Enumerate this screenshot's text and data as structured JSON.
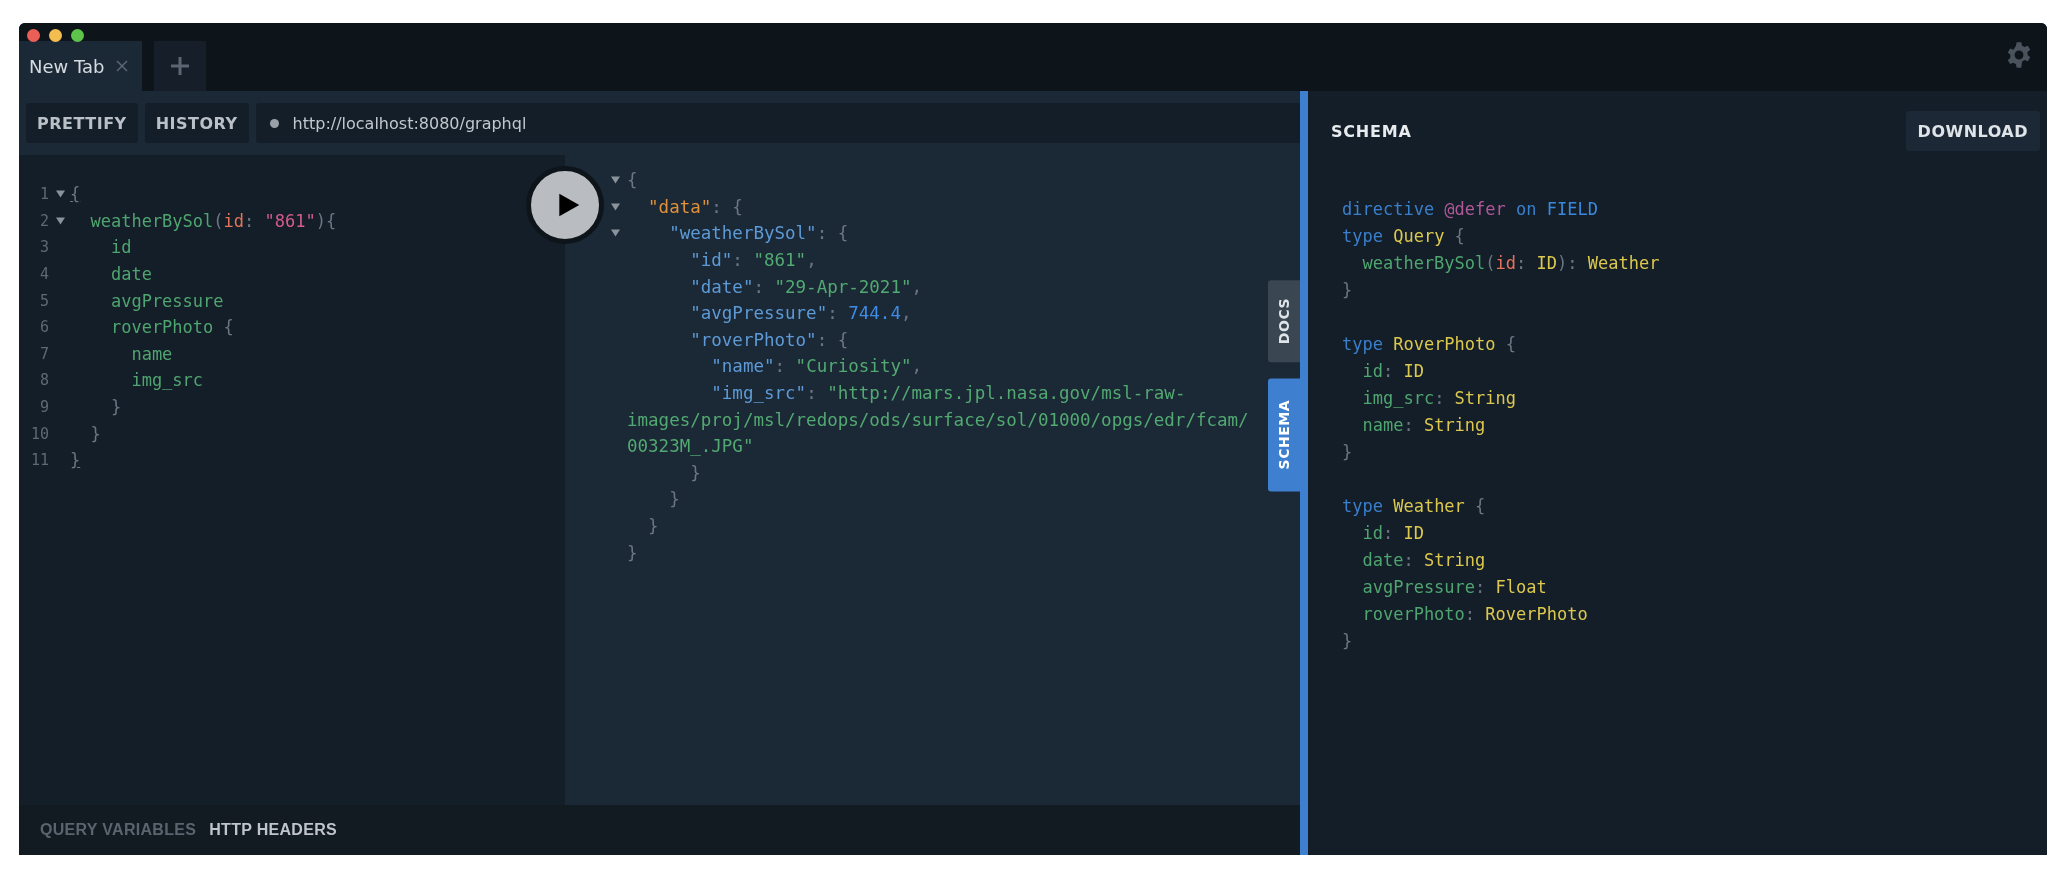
{
  "tabs": [
    {
      "label": "New Tab",
      "selected": true,
      "closable": true
    }
  ],
  "toolbar": {
    "buttons": [
      "PRETTIFY",
      "HISTORY"
    ],
    "url": "http://localhost:8080/graphql"
  },
  "query_editor": {
    "lines": [
      {
        "number": "1",
        "foldable": true,
        "tokens": [
          {
            "kind": "punct",
            "text": "{",
            "matched": true
          }
        ]
      },
      {
        "number": "2",
        "foldable": true,
        "tokens": [
          {
            "kind": "field",
            "text": "  weatherBySol"
          },
          {
            "kind": "punct",
            "text": "("
          },
          {
            "kind": "arg",
            "text": "id"
          },
          {
            "kind": "punct",
            "text": ": "
          },
          {
            "kind": "string",
            "text": "\"861\""
          },
          {
            "kind": "punct",
            "text": "){"
          }
        ]
      },
      {
        "number": "3",
        "foldable": false,
        "tokens": [
          {
            "kind": "field",
            "text": "    id"
          }
        ]
      },
      {
        "number": "4",
        "foldable": false,
        "tokens": [
          {
            "kind": "field",
            "text": "    date"
          }
        ]
      },
      {
        "number": "5",
        "foldable": false,
        "tokens": [
          {
            "kind": "field",
            "text": "    avgPressure"
          }
        ]
      },
      {
        "number": "6",
        "foldable": false,
        "tokens": [
          {
            "kind": "field",
            "text": "    roverPhoto"
          },
          {
            "kind": "punct",
            "text": " {"
          }
        ]
      },
      {
        "number": "7",
        "foldable": false,
        "tokens": [
          {
            "kind": "field",
            "text": "      name"
          }
        ]
      },
      {
        "number": "8",
        "foldable": false,
        "tokens": [
          {
            "kind": "field",
            "text": "      img_src"
          }
        ]
      },
      {
        "number": "9",
        "foldable": false,
        "tokens": [
          {
            "kind": "punct",
            "text": "    }"
          }
        ]
      },
      {
        "number": "10",
        "foldable": false,
        "tokens": [
          {
            "kind": "punct",
            "text": "  }"
          }
        ]
      },
      {
        "number": "11",
        "foldable": false,
        "tokens": [
          {
            "kind": "punct",
            "text": "}",
            "matched": true
          }
        ]
      }
    ]
  },
  "result_viewer": {
    "lines": [
      {
        "foldable": true,
        "tokens": [
          {
            "kind": "punct",
            "text": "{"
          }
        ]
      },
      {
        "foldable": true,
        "tokens": [
          {
            "kind": "datakey",
            "text": "  \"data\""
          },
          {
            "kind": "punct",
            "text": ": {"
          }
        ]
      },
      {
        "foldable": true,
        "tokens": [
          {
            "kind": "key",
            "text": "    \"weatherBySol\""
          },
          {
            "kind": "punct",
            "text": ": {"
          }
        ]
      },
      {
        "foldable": false,
        "tokens": [
          {
            "kind": "key",
            "text": "      \"id\""
          },
          {
            "kind": "punct",
            "text": ": "
          },
          {
            "kind": "value",
            "text": "\"861\""
          },
          {
            "kind": "punct",
            "text": ","
          }
        ]
      },
      {
        "foldable": false,
        "tokens": [
          {
            "kind": "key",
            "text": "      \"date\""
          },
          {
            "kind": "punct",
            "text": ": "
          },
          {
            "kind": "value",
            "text": "\"29-Apr-2021\""
          },
          {
            "kind": "punct",
            "text": ","
          }
        ]
      },
      {
        "foldable": false,
        "tokens": [
          {
            "kind": "key",
            "text": "      \"avgPressure\""
          },
          {
            "kind": "punct",
            "text": ": "
          },
          {
            "kind": "number",
            "text": "744.4"
          },
          {
            "kind": "punct",
            "text": ","
          }
        ]
      },
      {
        "foldable": false,
        "tokens": [
          {
            "kind": "key",
            "text": "      \"roverPhoto\""
          },
          {
            "kind": "punct",
            "text": ": {"
          }
        ]
      },
      {
        "foldable": false,
        "tokens": [
          {
            "kind": "key",
            "text": "        \"name\""
          },
          {
            "kind": "punct",
            "text": ": "
          },
          {
            "kind": "value",
            "text": "\"Curiosity\""
          },
          {
            "kind": "punct",
            "text": ","
          }
        ]
      },
      {
        "foldable": false,
        "tokens": [
          {
            "kind": "key",
            "text": "        \"img_src\""
          },
          {
            "kind": "punct",
            "text": ": "
          },
          {
            "kind": "value",
            "text": "\"http://mars.jpl.nasa.gov/msl-raw-"
          }
        ]
      },
      {
        "foldable": false,
        "tokens": [
          {
            "kind": "value",
            "text": "images/proj/msl/redops/ods/surface/sol/01000/opgs/edr/fcam/"
          }
        ]
      },
      {
        "foldable": false,
        "tokens": [
          {
            "kind": "value",
            "text": "00323M_.JPG\""
          }
        ]
      },
      {
        "foldable": false,
        "tokens": [
          {
            "kind": "punct",
            "text": "      }"
          }
        ]
      },
      {
        "foldable": false,
        "tokens": [
          {
            "kind": "punct",
            "text": "    }"
          }
        ]
      },
      {
        "foldable": false,
        "tokens": [
          {
            "kind": "punct",
            "text": "  }"
          }
        ]
      },
      {
        "foldable": false,
        "tokens": [
          {
            "kind": "punct",
            "text": "}"
          }
        ]
      }
    ]
  },
  "side_tabs": [
    {
      "label": "DOCS",
      "selected": false
    },
    {
      "label": "SCHEMA",
      "selected": true
    }
  ],
  "schema_panel": {
    "title": "SCHEMA",
    "download_button": "DOWNLOAD",
    "blocks": [
      {
        "lines": [
          {
            "tokens": [
              {
                "kind": "keyword",
                "text": "directive "
              },
              {
                "kind": "directive",
                "text": "@defer"
              },
              {
                "kind": "keyword",
                "text": " on "
              },
              {
                "kind": "enum",
                "text": "FIELD"
              }
            ]
          },
          {
            "tokens": [
              {
                "kind": "keyword",
                "text": "type "
              },
              {
                "kind": "type",
                "text": "Query"
              },
              {
                "kind": "punct",
                "text": " {"
              }
            ]
          },
          {
            "tokens": [
              {
                "kind": "field",
                "text": "  weatherBySol"
              },
              {
                "kind": "punct",
                "text": "("
              },
              {
                "kind": "arg",
                "text": "id"
              },
              {
                "kind": "punct",
                "text": ": "
              },
              {
                "kind": "type",
                "text": "ID"
              },
              {
                "kind": "punct",
                "text": "): "
              },
              {
                "kind": "type",
                "text": "Weather"
              }
            ]
          },
          {
            "tokens": [
              {
                "kind": "punct",
                "text": "}"
              }
            ]
          }
        ]
      },
      {
        "lines": [
          {
            "tokens": [
              {
                "kind": "keyword",
                "text": "type "
              },
              {
                "kind": "type",
                "text": "RoverPhoto"
              },
              {
                "kind": "punct",
                "text": " {"
              }
            ]
          },
          {
            "tokens": [
              {
                "kind": "field",
                "text": "  id"
              },
              {
                "kind": "punct",
                "text": ": "
              },
              {
                "kind": "type",
                "text": "ID"
              }
            ]
          },
          {
            "tokens": [
              {
                "kind": "field",
                "text": "  img_src"
              },
              {
                "kind": "punct",
                "text": ": "
              },
              {
                "kind": "type",
                "text": "String"
              }
            ]
          },
          {
            "tokens": [
              {
                "kind": "field",
                "text": "  name"
              },
              {
                "kind": "punct",
                "text": ": "
              },
              {
                "kind": "type",
                "text": "String"
              }
            ]
          },
          {
            "tokens": [
              {
                "kind": "punct",
                "text": "}"
              }
            ]
          }
        ]
      },
      {
        "lines": [
          {
            "tokens": [
              {
                "kind": "keyword",
                "text": "type "
              },
              {
                "kind": "type",
                "text": "Weather"
              },
              {
                "kind": "punct",
                "text": " {"
              }
            ]
          },
          {
            "tokens": [
              {
                "kind": "field",
                "text": "  id"
              },
              {
                "kind": "punct",
                "text": ": "
              },
              {
                "kind": "type",
                "text": "ID"
              }
            ]
          },
          {
            "tokens": [
              {
                "kind": "field",
                "text": "  date"
              },
              {
                "kind": "punct",
                "text": ": "
              },
              {
                "kind": "type",
                "text": "String"
              }
            ]
          },
          {
            "tokens": [
              {
                "kind": "field",
                "text": "  avgPressure"
              },
              {
                "kind": "punct",
                "text": ": "
              },
              {
                "kind": "type",
                "text": "Float"
              }
            ]
          },
          {
            "tokens": [
              {
                "kind": "field",
                "text": "  roverPhoto"
              },
              {
                "kind": "punct",
                "text": ": "
              },
              {
                "kind": "type",
                "text": "RoverPhoto"
              }
            ]
          },
          {
            "tokens": [
              {
                "kind": "punct",
                "text": "}"
              }
            ]
          }
        ]
      }
    ]
  },
  "bottom_tabs": [
    {
      "label": "QUERY VARIABLES",
      "selected": false
    },
    {
      "label": "HTTP HEADERS",
      "selected": true
    }
  ]
}
